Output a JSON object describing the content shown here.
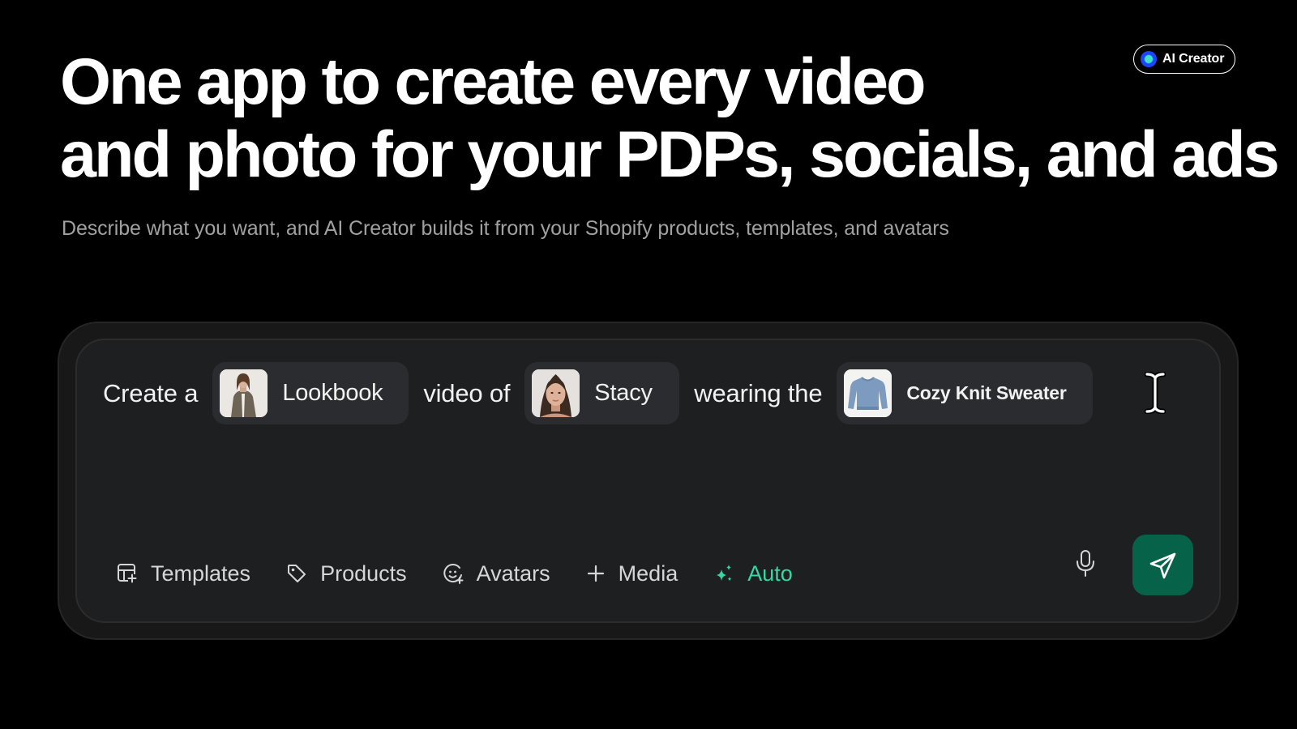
{
  "badge": {
    "label": "AI Creator"
  },
  "hero": {
    "headline_line1": "One app to create every video",
    "headline_line2": "and photo for your PDPs, socials, and ads",
    "subhead": "Describe what you want, and AI Creator builds it from your Shopify products, templates, and avatars"
  },
  "prompt": {
    "word_1": "Create a",
    "chip_template": "Lookbook",
    "word_2": "video of",
    "chip_avatar": "Stacy",
    "word_3": "wearing the",
    "chip_product": "Cozy Knit Sweater"
  },
  "toolbar": {
    "templates": "Templates",
    "products": "Products",
    "avatars": "Avatars",
    "media": "Media",
    "auto": "Auto"
  },
  "colors": {
    "background": "#000000",
    "card": "#1e1f21",
    "chip": "#2b2c2f",
    "accent": "#37d6a5",
    "send_button": "#07624a"
  },
  "icons": {
    "templates": "templates-icon",
    "products": "tag-icon",
    "avatars": "avatar-icon",
    "media": "plus-icon",
    "auto": "sparkles-icon",
    "mic": "microphone-icon",
    "send": "send-icon",
    "cursor": "text-cursor-icon"
  }
}
